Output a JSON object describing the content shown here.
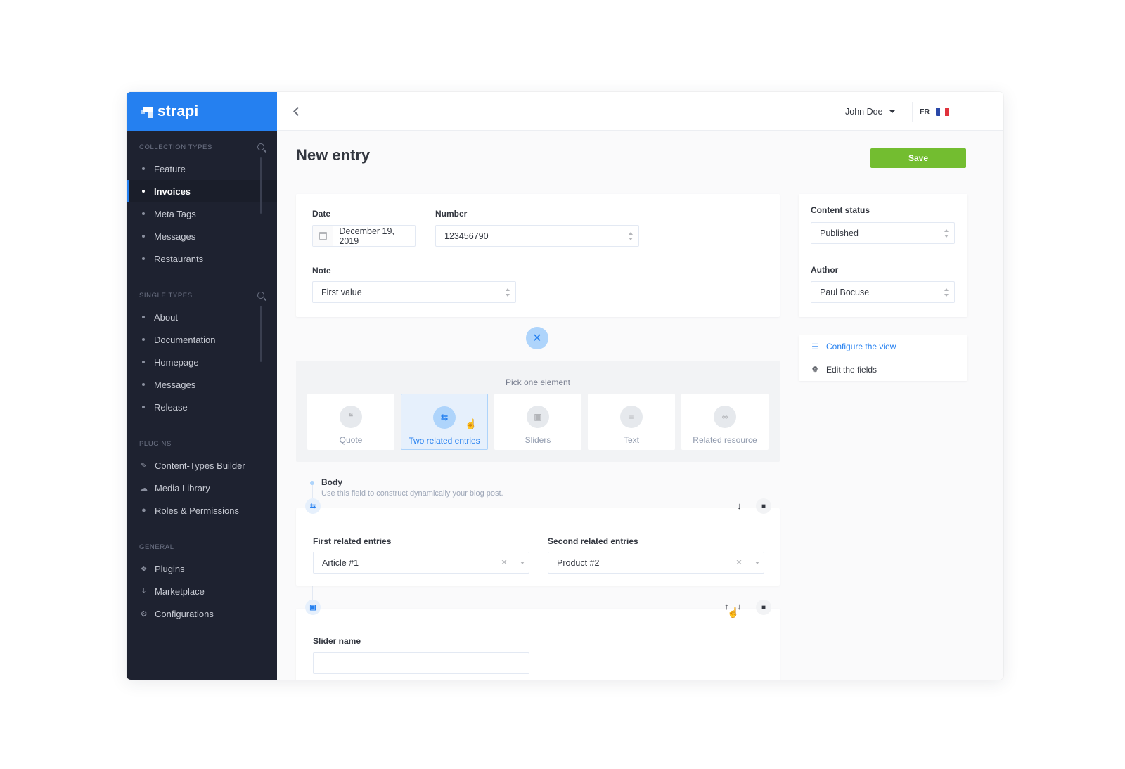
{
  "brand": {
    "name": "strapi"
  },
  "sidebar": {
    "collection_types_title": "COLLECTION TYPES",
    "collection_types": [
      "Feature",
      "Invoices",
      "Meta Tags",
      "Messages",
      "Restaurants"
    ],
    "active_item": "Invoices",
    "single_types_title": "SINGLE TYPES",
    "single_types": [
      "About",
      "Documentation",
      "Homepage",
      "Messages",
      "Release"
    ],
    "plugins_title": "PLUGINS",
    "plugins": [
      {
        "label": "Content-Types Builder",
        "icon": "paintbrush-icon"
      },
      {
        "label": "Media Library",
        "icon": "cloud-upload-icon"
      },
      {
        "label": "Roles & Permissions",
        "icon": "users-icon"
      }
    ],
    "general_title": "GENERAL",
    "general": [
      {
        "label": "Plugins",
        "icon": "puzzle-icon"
      },
      {
        "label": "Marketplace",
        "icon": "download-icon"
      },
      {
        "label": "Configurations",
        "icon": "gear-icon"
      }
    ]
  },
  "topbar": {
    "user": "John Doe",
    "lang": "FR"
  },
  "page": {
    "title": "New entry",
    "save_label": "Save"
  },
  "form": {
    "date_label": "Date",
    "date_value": "December 19, 2019",
    "number_label": "Number",
    "number_value": "123456790",
    "note_label": "Note",
    "note_value": "First value"
  },
  "side_panel": {
    "status_label": "Content status",
    "status_value": "Published",
    "author_label": "Author",
    "author_value": "Paul Bocuse",
    "configure_link": "Configure the view",
    "edit_link": "Edit the fields"
  },
  "picker": {
    "title": "Pick one element",
    "options": [
      "Quote",
      "Two related entries",
      "Sliders",
      "Text",
      "Related resource"
    ],
    "selected": "Two related entries"
  },
  "dynamic_zone": {
    "label": "Body",
    "help": "Use this field to construct dynamically your blog post.",
    "first_related_label": "First related entries",
    "first_related_value": "Article #1",
    "second_related_label": "Second related entries",
    "second_related_value": "Product #2",
    "slider_name_label": "Slider name"
  },
  "colors": {
    "brand_blue": "#2580f0",
    "save_green": "#73bd30",
    "sidebar_bg": "#1e2230"
  }
}
